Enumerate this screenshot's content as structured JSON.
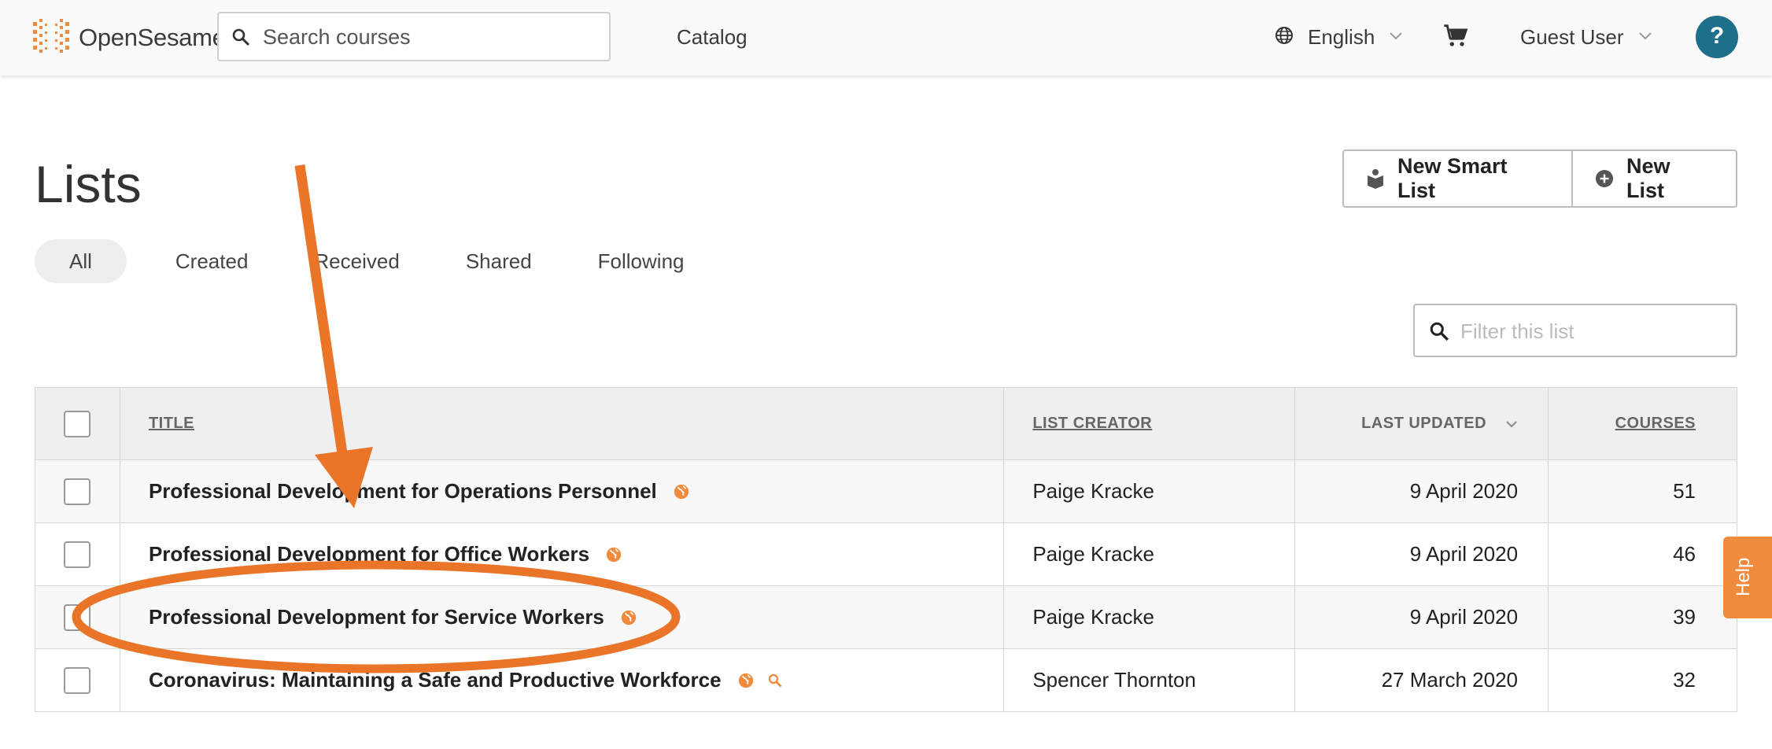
{
  "header": {
    "logo_text": "OpenSesame",
    "search_placeholder": "Search courses",
    "nav_catalog": "Catalog",
    "language": "English",
    "user": "Guest User",
    "help_symbol": "?"
  },
  "page": {
    "title": "Lists",
    "buttons": {
      "new_smart_list": "New Smart List",
      "new_list": "New List"
    },
    "tabs": [
      "All",
      "Created",
      "Received",
      "Shared",
      "Following"
    ],
    "active_tab": "All",
    "filter_placeholder": "Filter this list"
  },
  "table": {
    "headers": {
      "title": "TITLE",
      "list_creator": "LIST CREATOR",
      "last_updated": "LAST UPDATED",
      "courses": "COURSES"
    },
    "sort_column": "last_updated",
    "rows": [
      {
        "title": "Professional Development for Operations Personnel",
        "creator": "Paige Kracke",
        "updated": "9 April 2020",
        "courses": "51",
        "icons": [
          "globe-icon"
        ]
      },
      {
        "title": "Professional Development for Office Workers",
        "creator": "Paige Kracke",
        "updated": "9 April 2020",
        "courses": "46",
        "icons": [
          "globe-icon"
        ]
      },
      {
        "title": "Professional Development for Service Workers",
        "creator": "Paige Kracke",
        "updated": "9 April 2020",
        "courses": "39",
        "icons": [
          "globe-icon"
        ]
      },
      {
        "title": "Coronavirus: Maintaining a Safe and Productive Workforce",
        "creator": "Spencer Thornton",
        "updated": "27 March 2020",
        "courses": "32",
        "icons": [
          "globe-icon",
          "smart-search-icon"
        ]
      }
    ]
  },
  "side_help": "Help",
  "colors": {
    "brand_orange": "#f08a3c",
    "annotation_orange": "#ea7428",
    "help_blue": "#1f6f8b"
  },
  "annotation": {
    "arrow_target_row": 2,
    "circled_row": 2
  }
}
